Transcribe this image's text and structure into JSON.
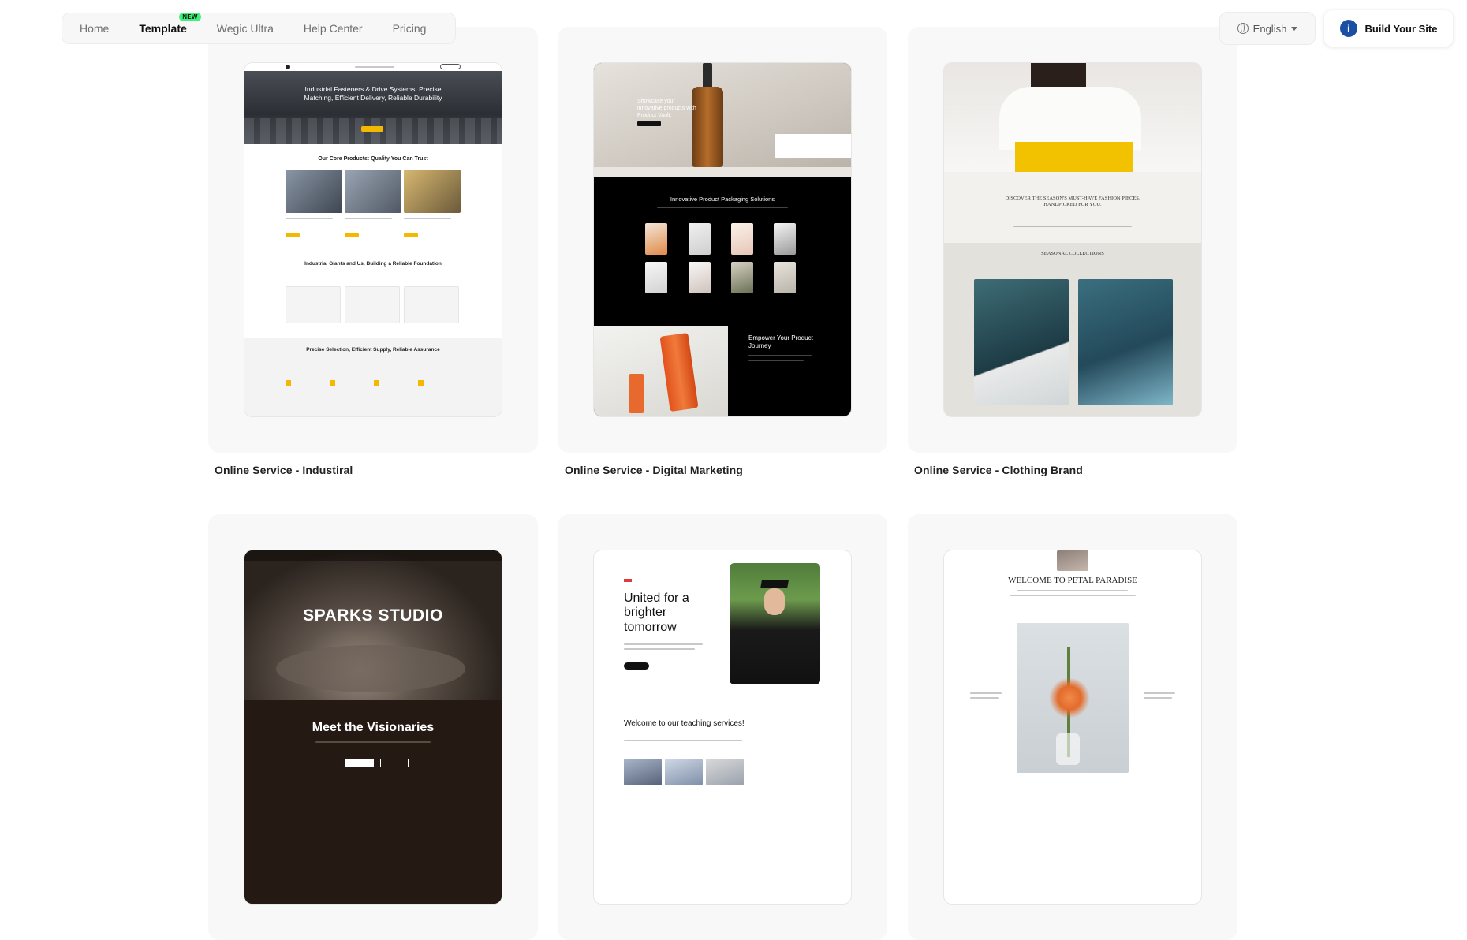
{
  "nav": {
    "items": [
      {
        "label": "Home",
        "active": false
      },
      {
        "label": "Template",
        "active": true,
        "badge": "NEW"
      },
      {
        "label": "Wegic Ultra",
        "active": false
      },
      {
        "label": "Help Center",
        "active": false
      },
      {
        "label": "Pricing",
        "active": false
      }
    ]
  },
  "language": {
    "label": "English",
    "icon": "globe-icon"
  },
  "build_button": {
    "label": "Build Your Site",
    "logo": "i"
  },
  "templates": [
    {
      "title": "Online Service - Industiral",
      "hero": "Industrial Fasteners & Drive Systems: Precise Matching, Efficient Delivery, Reliable Durability",
      "section1": "Our Core Products: Quality You Can Trust",
      "section2": "Industrial Giants and Us, Building a Reliable Foundation",
      "section3": "Precise Selection, Efficient Supply, Reliable Assurance",
      "accent": "#f5b800"
    },
    {
      "title": "Online Service - Digital Marketing",
      "hero": "Showcase your innovative products with Product Vault.",
      "section1": "Innovative Product Packaging Solutions",
      "section2": "Empower Your Product Journey"
    },
    {
      "title": "Online Service - Clothing Brand",
      "hero": "DISCOVER THE SEASON'S MUST-HAVE FASHION PIECES, HANDPICKED FOR YOU.",
      "section1": "SEASONAL COLLECTIONS"
    },
    {
      "title": "",
      "hero": "SPARKS STUDIO",
      "section1": "Meet the Visionaries"
    },
    {
      "title": "",
      "hero": "United for a brighter tomorrow",
      "section1": "Welcome to our teaching services!"
    },
    {
      "title": "",
      "hero": "WELCOME TO PETAL PARADISE"
    }
  ]
}
